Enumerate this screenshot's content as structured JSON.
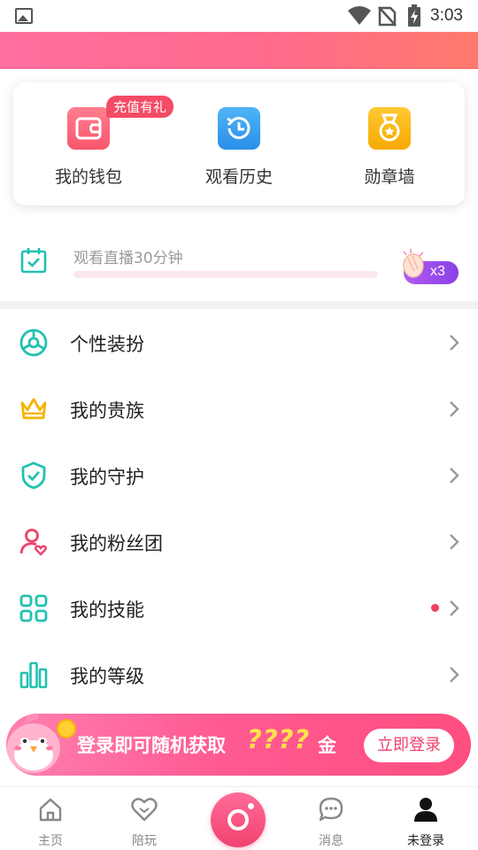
{
  "status_bar": {
    "time": "3:03"
  },
  "quick_actions": [
    {
      "label": "我的钱包",
      "icon": "wallet-icon",
      "badge": "充值有礼",
      "color": "#f8566d"
    },
    {
      "label": "观看历史",
      "icon": "history-icon",
      "color": "#2a8fe8"
    },
    {
      "label": "勋章墙",
      "icon": "medal-icon",
      "color": "#f6a900"
    }
  ],
  "task": {
    "text": "观看直播30分钟",
    "progress": 0,
    "reward": "x3"
  },
  "menu": [
    {
      "label": "个性装扮",
      "icon": "theme-icon"
    },
    {
      "label": "我的贵族",
      "icon": "crown-icon"
    },
    {
      "label": "我的守护",
      "icon": "shield-icon"
    },
    {
      "label": "我的粉丝团",
      "icon": "fan-club-icon"
    },
    {
      "label": "我的技能",
      "icon": "skills-grid-icon",
      "has_dot": true
    },
    {
      "label": "我的等级",
      "icon": "level-bars-icon"
    }
  ],
  "login_banner": {
    "text": "登录即可随机获取",
    "amount": "????",
    "unit": "金",
    "button": "立即登录"
  },
  "bottom_nav": [
    {
      "label": "主页",
      "icon": "home-icon"
    },
    {
      "label": "陪玩",
      "icon": "heart-icon"
    },
    {
      "label": "",
      "icon": "live-camera-icon"
    },
    {
      "label": "消息",
      "icon": "message-icon"
    },
    {
      "label": "未登录",
      "icon": "user-icon",
      "active": true
    }
  ],
  "colors": {
    "brand_pink": "#ff5a93",
    "accent_teal": "#22c1b0",
    "accent_gold": "#f6b400"
  }
}
